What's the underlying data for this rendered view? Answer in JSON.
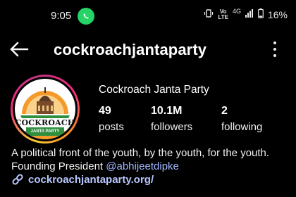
{
  "status_bar": {
    "time": "9:05",
    "app_icon": "whatsapp-icon",
    "volte": "Vo",
    "lte": "LTE",
    "network": "4G",
    "battery_percent": "16%"
  },
  "header": {
    "username": "cockroachjantaparty",
    "back_icon": "arrow-left-icon",
    "more_icon": "more-vertical-icon"
  },
  "profile": {
    "avatar_logo_text": "COCKROACH",
    "avatar_logo_subtext": "JANTA PARTY",
    "display_name": "Cockroach Janta Party",
    "stats": [
      {
        "value": "49",
        "label": "posts"
      },
      {
        "value": "10.1M",
        "label": "followers"
      },
      {
        "value": "2",
        "label": "following"
      }
    ],
    "bio_text": "A political front of the youth, by the youth, for the youth. Founding President ",
    "bio_mention": "@abhijeetdipke",
    "link": "cockroachjantaparty.org/"
  },
  "colors": {
    "background": "#000000",
    "link": "#b8c8ff",
    "mention": "#9fb7ff",
    "whatsapp": "#25d366"
  }
}
